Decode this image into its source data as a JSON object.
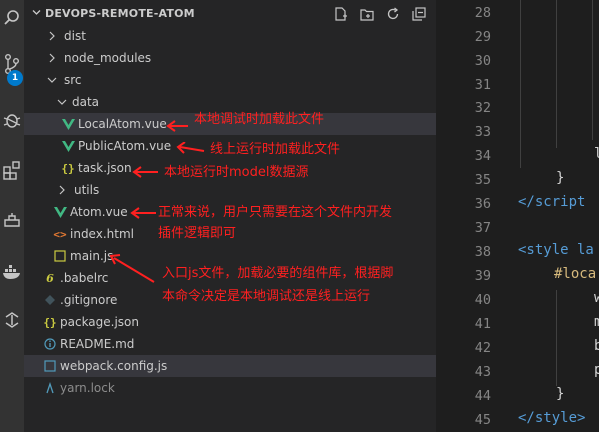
{
  "explorer": {
    "project_title": "DEVOPS-REMOTE-ATOM",
    "actions": [
      "new-file-icon",
      "new-folder-icon",
      "refresh-icon",
      "collapse-all-icon"
    ]
  },
  "activity_bar": {
    "icons": [
      "search-icon",
      "source-control-icon",
      "debug-icon",
      "extensions-icon",
      "docker-icon",
      "remote-icon",
      "live-share-icon"
    ],
    "scm_badge": "1"
  },
  "tree": [
    {
      "label": "dist",
      "type": "folder",
      "depth": 1,
      "collapsed": true,
      "dim": false
    },
    {
      "label": "node_modules",
      "type": "folder",
      "depth": 1,
      "collapsed": true,
      "dim": false
    },
    {
      "label": "src",
      "type": "folder",
      "depth": 1,
      "collapsed": false,
      "dim": false
    },
    {
      "label": "data",
      "type": "folder",
      "depth": 2,
      "collapsed": false,
      "dim": false
    },
    {
      "label": "LocalAtom.vue",
      "type": "vue",
      "depth": 3,
      "selected": true
    },
    {
      "label": "PublicAtom.vue",
      "type": "vue",
      "depth": 3
    },
    {
      "label": "task.json",
      "type": "json",
      "depth": 3
    },
    {
      "label": "utils",
      "type": "folder",
      "depth": 2,
      "collapsed": true
    },
    {
      "label": "Atom.vue",
      "type": "vue",
      "depth": 2
    },
    {
      "label": "index.html",
      "type": "html",
      "depth": 2
    },
    {
      "label": "main.js",
      "type": "js",
      "depth": 2
    },
    {
      "label": ".babelrc",
      "type": "babel",
      "depth": 1
    },
    {
      "label": ".gitignore",
      "type": "git",
      "depth": 1
    },
    {
      "label": "package.json",
      "type": "json",
      "depth": 1
    },
    {
      "label": "README.md",
      "type": "info",
      "depth": 1
    },
    {
      "label": "webpack.config.js",
      "type": "js-blue",
      "depth": 1,
      "hover": true
    },
    {
      "label": "yarn.lock",
      "type": "yarn",
      "depth": 1,
      "dim": true
    }
  ],
  "annotations": {
    "local_atom": "本地调试时加载此文件",
    "public_atom": "线上运行时加载此文件",
    "task_json": "本地运行时model数据源",
    "atom_vue_1": "正常来说，用户只需要在这个文件内开发",
    "atom_vue_2": "插件逻辑即可",
    "main_js_1": "入口js文件，加载必要的组件库，根据脚",
    "main_js_2": "本命令决定是本地调试还是线上运行"
  },
  "editor": {
    "line_numbers": [
      "28",
      "29",
      "30",
      "31",
      "32",
      "33",
      "34",
      "35",
      "36",
      "37",
      "38",
      "39",
      "40",
      "41",
      "42",
      "43",
      "44",
      "45"
    ],
    "lines": {
      "35": "}",
      "36": "</script",
      "38": "<style la",
      "39": "#loca",
      "40": "w",
      "41": "m",
      "42": "b",
      "43": "p",
      "44": "}",
      "45": "</style>"
    },
    "line_34_fragment": "l"
  }
}
